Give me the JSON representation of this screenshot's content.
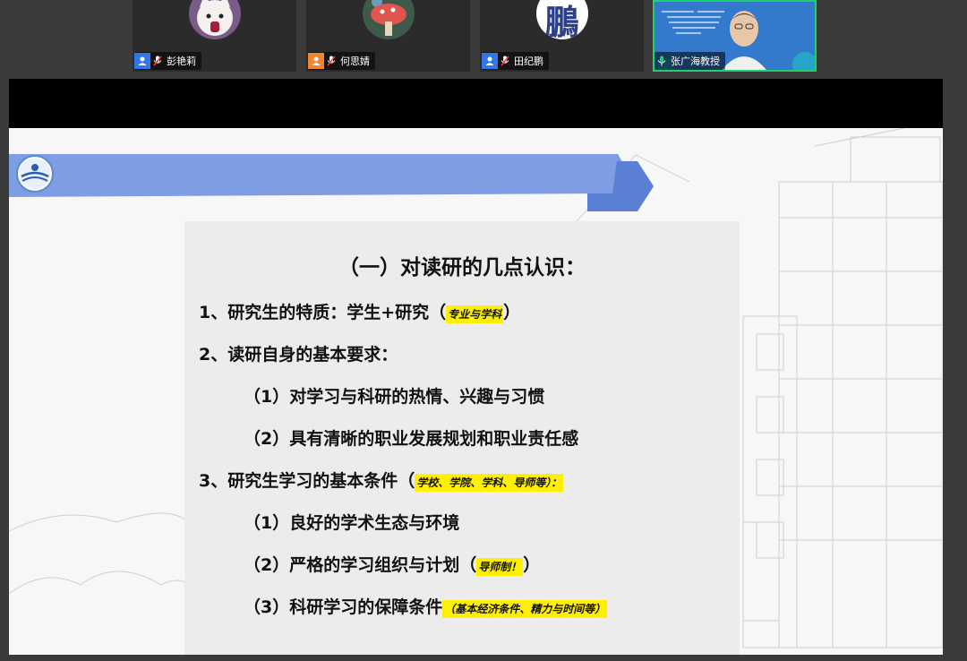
{
  "participants": [
    {
      "name": "彭艳莉",
      "role_color": "#2f78e8",
      "avatar": "cat-avatar"
    },
    {
      "name": "何思婧",
      "role_color": "#f2862e",
      "avatar": "mushroom-avatar"
    },
    {
      "name": "田纪鹏",
      "role_color": "#2f78e8",
      "avatar": "text-avatar",
      "avatar_text": "鵬"
    },
    {
      "name": "张广海教授",
      "speaking": true,
      "avatar": "video-feed"
    }
  ],
  "slide": {
    "title": "（一）对读研的几点认识：",
    "items": [
      {
        "text": "1、研究生的特质：学生+研究（",
        "highlight": "专业与学科",
        "tail": "）"
      },
      {
        "text": "2、读研自身的基本要求："
      },
      {
        "text": "（1）对学习与科研的热情、兴趣与习惯"
      },
      {
        "text": "（2）具有清晰的职业发展规划和职业责任感"
      },
      {
        "text": "3、研究生学习的基本条件（",
        "highlight": "学校、学院、学科、导师等）："
      },
      {
        "text": "（1）良好的学术生态与环境"
      },
      {
        "text": "（2）严格的学习组织与计划（",
        "highlight": "导师制！",
        "tail": "）"
      },
      {
        "text": "（3）科研学习的保障条件",
        "highlight": "（基本经济条件、精力与时间等）"
      }
    ]
  },
  "colors": {
    "banner": "#7a98e0",
    "highlight": "#ffef00",
    "speaking_border": "#1fd070"
  }
}
